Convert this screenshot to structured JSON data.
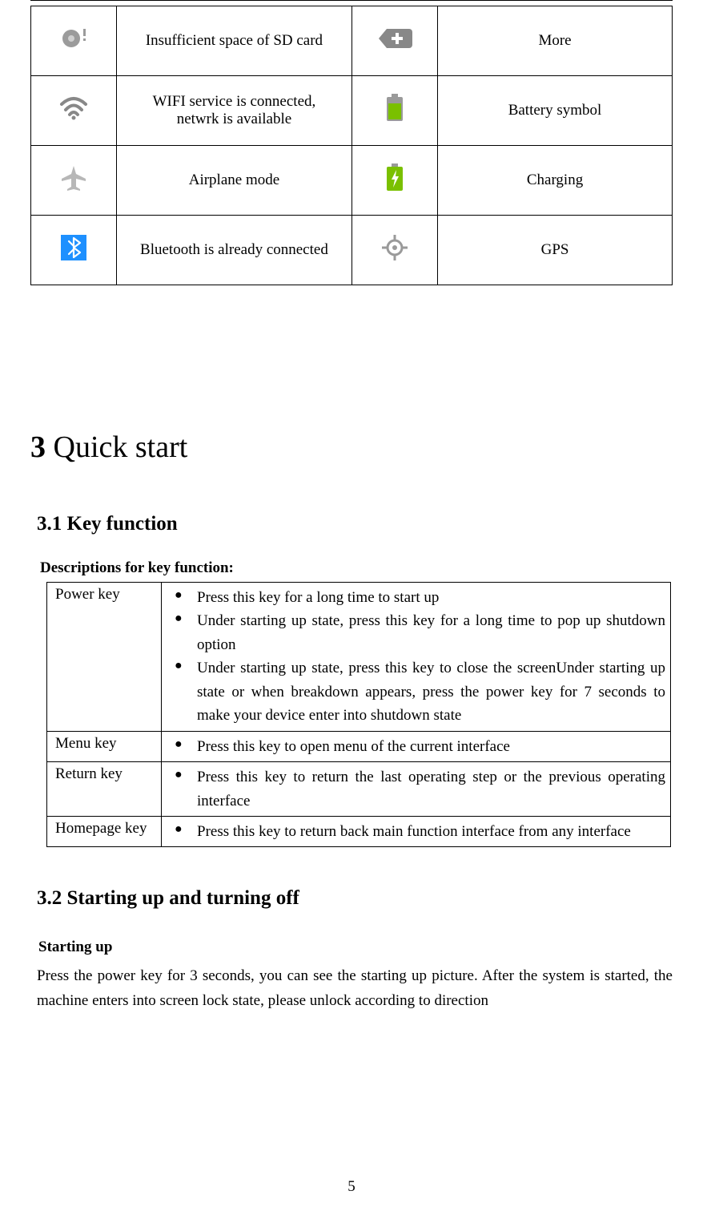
{
  "icons": {
    "r1c1": "Insufficient space of SD card",
    "r1c2": "More",
    "r2c1_line1": "WIFI service is connected,",
    "r2c1_line2": "netwrk is available",
    "r2c2": "Battery symbol",
    "r3c1": "Airplane mode",
    "r3c2": "Charging",
    "r4c1": "Bluetooth is already connected",
    "r4c2": "GPS"
  },
  "headings": {
    "h1_num": "3",
    "h1_text": " Quick start",
    "h2_1": "3.1  Key function",
    "descline": "Descriptions for key function:",
    "h2_2": "3.2  Starting up and turning off",
    "subhead": "Starting up"
  },
  "keys": {
    "power_name": "Power key",
    "power_b1": "Press this key for a long time to start up",
    "power_b2": "Under starting up state, press this key for a long time to pop up shutdown option",
    "power_b3": "Under starting up state, press this key to close the screenUnder starting up state or when breakdown appears, press the power key for 7 seconds to make your device enter into shutdown state",
    "menu_name": "Menu key",
    "menu_b1": "Press this key to open menu of the current interface",
    "return_name": "Return key",
    "return_b1": "Press this key to return the last operating step or the previous operating interface",
    "home_name": "Homepage key",
    "home_b1": "Press this key to return back main function interface from any interface"
  },
  "body": {
    "starting_up": "Press the power key for 3 seconds, you can see the starting up picture. After the system is started, the machine enters into screen lock state, please unlock according to direction"
  },
  "page_number": "5"
}
